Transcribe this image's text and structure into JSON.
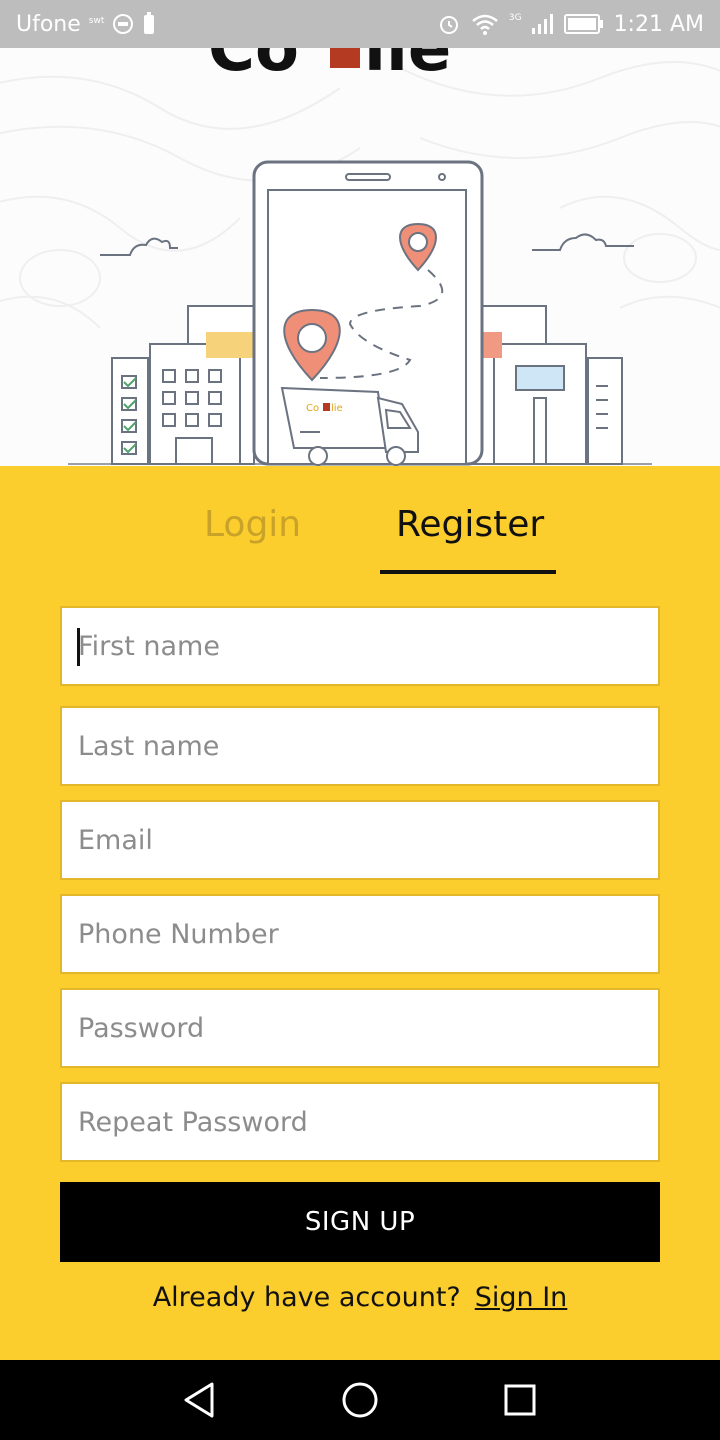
{
  "status_bar": {
    "carrier": "Ufone",
    "carrier_sub": "swt",
    "network": "3G",
    "time": "1:21 AM"
  },
  "hero": {
    "logo_text": "Co  lie",
    "truck_logo_text": "Co lie"
  },
  "tabs": {
    "login": "Login",
    "register": "Register"
  },
  "form": {
    "first_name_placeholder": "First name",
    "last_name_placeholder": "Last name",
    "email_placeholder": "Email",
    "phone_placeholder": "Phone Number",
    "password_placeholder": "Password",
    "repeat_password_placeholder": "Repeat Password",
    "signup_label": "SIGN UP"
  },
  "footer": {
    "prompt": "Already have account?",
    "link": "Sign In"
  },
  "icons": {
    "back": "back-triangle-icon",
    "home": "home-circle-icon",
    "recents": "recents-square-icon"
  },
  "colors": {
    "panel": "#fbce2e",
    "button": "#000000",
    "status_bar": "#bdbdbd",
    "pin": "#ef8f78"
  }
}
